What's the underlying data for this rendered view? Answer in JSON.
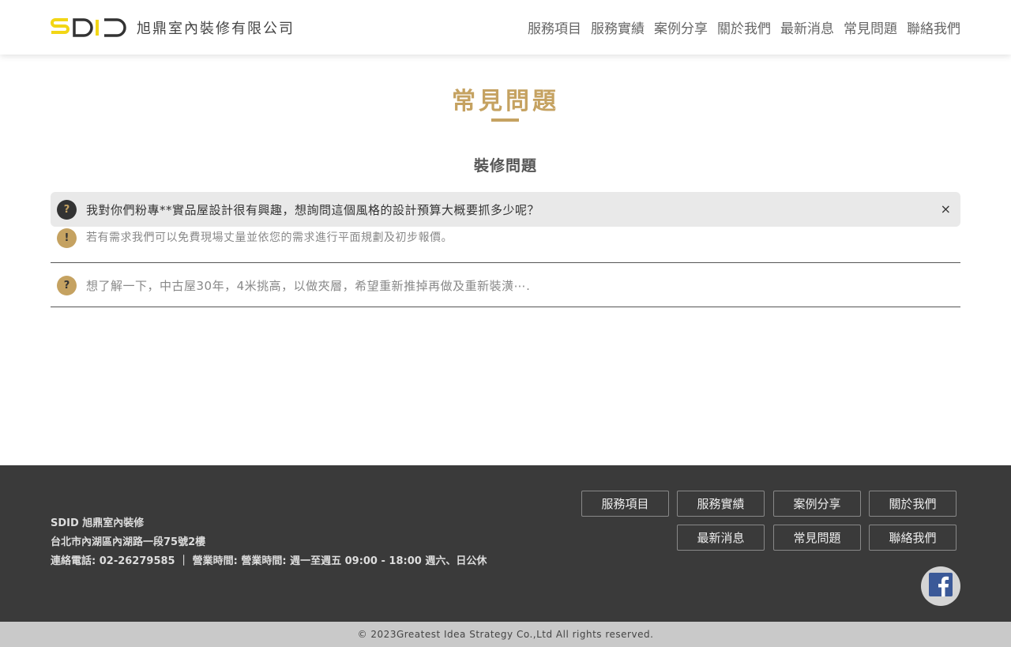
{
  "header": {
    "logo_mark": "SDID",
    "company_name": "旭鼎室內裝修有限公司",
    "nav": [
      "服務項目",
      "服務實績",
      "案例分享",
      "關於我們",
      "最新消息",
      "常見問題",
      "聯絡我們"
    ]
  },
  "main": {
    "page_title": "常見問題",
    "section_title": "裝修問題",
    "faqs": [
      {
        "question_badge": "?",
        "question": "我對你們粉專**實品屋設計很有興趣，想詢問這個風格的設計預算大概要抓多少呢？",
        "close_icon": "×",
        "answer_badge": "!",
        "answer": "若有需求我們可以免費現場丈量並依您的需求進行平面規劃及初步報價。"
      },
      {
        "question_badge": "?",
        "question": "想了解一下，中古屋30年，4米挑高，以做夾層，希望重新推掉再做及重新裝潢⋯."
      }
    ]
  },
  "footer": {
    "name": "SDID 旭鼎室內裝修",
    "address": "台北市內湖區內湖路一段75號2樓",
    "contact": "連絡電話: 02-26279585 ｜ 營業時間: 營業時間: 週一至週五 09:00 - 18:00 週六、日公休",
    "buttons": [
      "服務項目",
      "服務實績",
      "案例分享",
      "關於我們",
      "最新消息",
      "常見問題",
      "聯絡我們"
    ],
    "facebook_icon": "facebook-icon",
    "copyright": "© 2023Greatest Idea Strategy Co.,Ltd All rights reserved."
  },
  "colors": {
    "accent_gold": "#c5a261",
    "logo_yellow": "#f2d615",
    "footer_bg": "#3a3a3a",
    "copyright_bg": "#c9c9c9"
  }
}
